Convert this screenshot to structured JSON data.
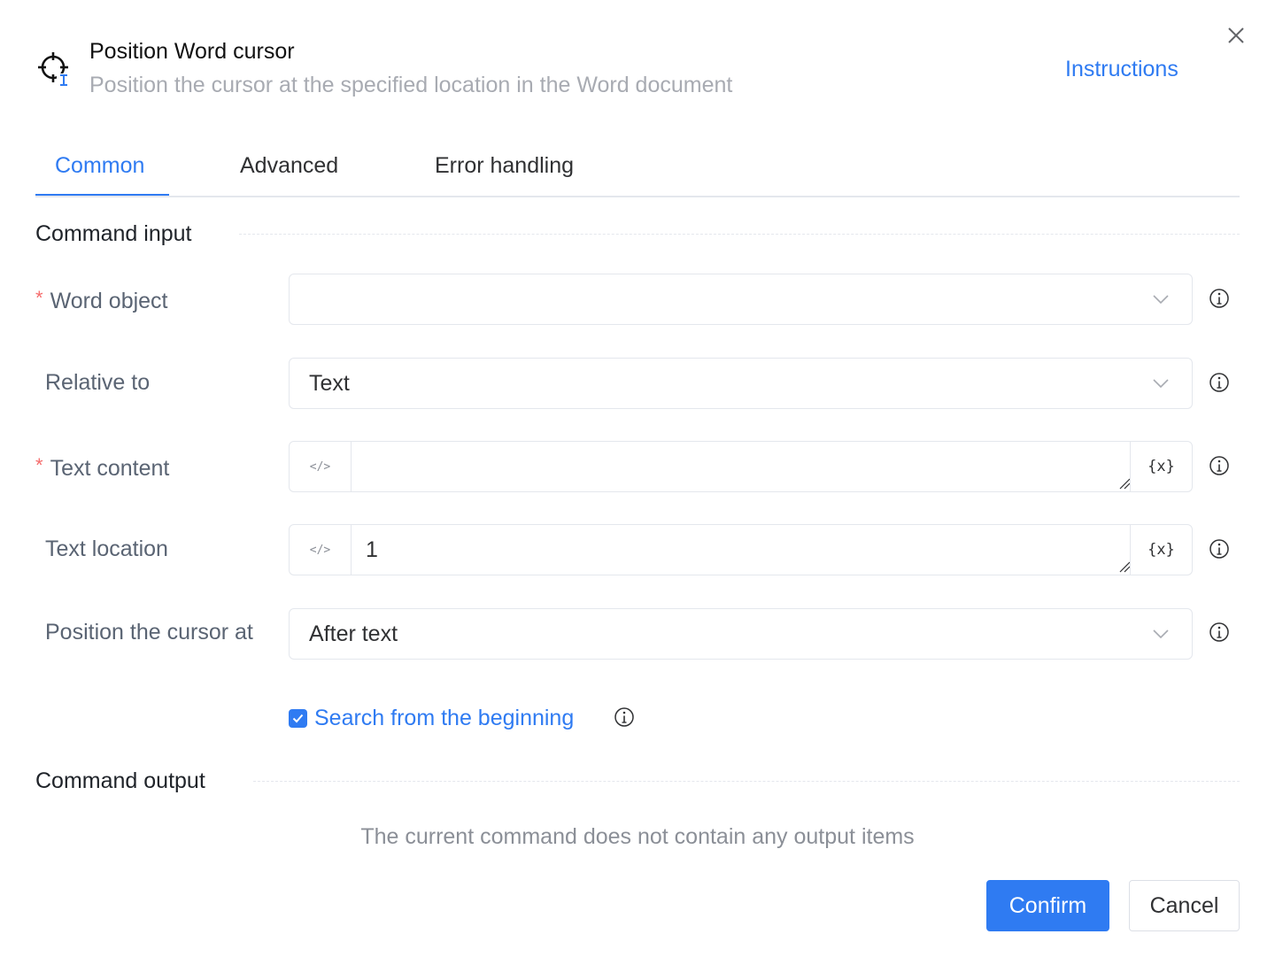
{
  "header": {
    "title": "Position Word cursor",
    "subtitle": "Position the cursor at the specified location in the Word document",
    "instructions_link": "Instructions",
    "icon": "crosshair-cursor-icon"
  },
  "tabs": [
    {
      "label": "Common",
      "active": true
    },
    {
      "label": "Advanced",
      "active": false
    },
    {
      "label": "Error handling",
      "active": false
    }
  ],
  "command_input": {
    "title": "Command input",
    "word_object": {
      "label": "Word object",
      "required": true,
      "value": ""
    },
    "relative_to": {
      "label": "Relative to",
      "value": "Text"
    },
    "text_content": {
      "label": "Text content",
      "required": true,
      "value": "",
      "code_glyph": "</>",
      "var_glyph": "{x}"
    },
    "text_location": {
      "label": "Text location",
      "value": "1",
      "code_glyph": "</>",
      "var_glyph": "{x}"
    },
    "cursor_position": {
      "label": "Position the cursor at",
      "value": "After text"
    },
    "search_from_beginning": {
      "label": "Search from the beginning",
      "checked": true
    }
  },
  "command_output": {
    "title": "Command output",
    "empty_message": "The current command does not contain any output items"
  },
  "footer": {
    "confirm_label": "Confirm",
    "cancel_label": "Cancel"
  },
  "required_mark": "*",
  "colors": {
    "accent": "#2f7bf2",
    "required": "#f56c6c",
    "muted": "#a8abb2"
  }
}
